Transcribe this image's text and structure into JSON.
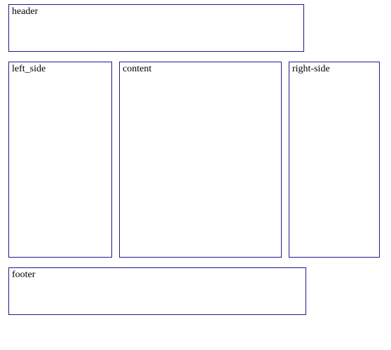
{
  "layout": {
    "header_label": "header",
    "left_side_label": "left_side",
    "content_label": "content",
    "right_side_label": "right-side",
    "footer_label": "footer"
  }
}
